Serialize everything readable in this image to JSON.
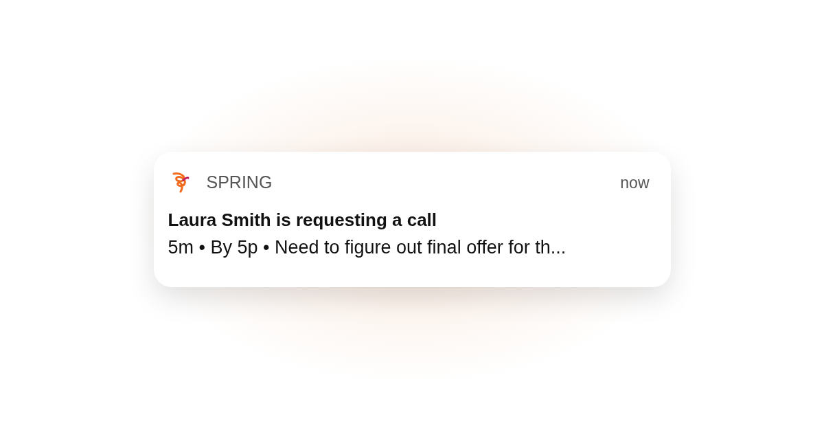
{
  "notification": {
    "app_name": "SPRING",
    "time": "now",
    "title": "Laura Smith is requesting a call",
    "body": "5m • By 5p • Need to figure out final offer for th..."
  }
}
